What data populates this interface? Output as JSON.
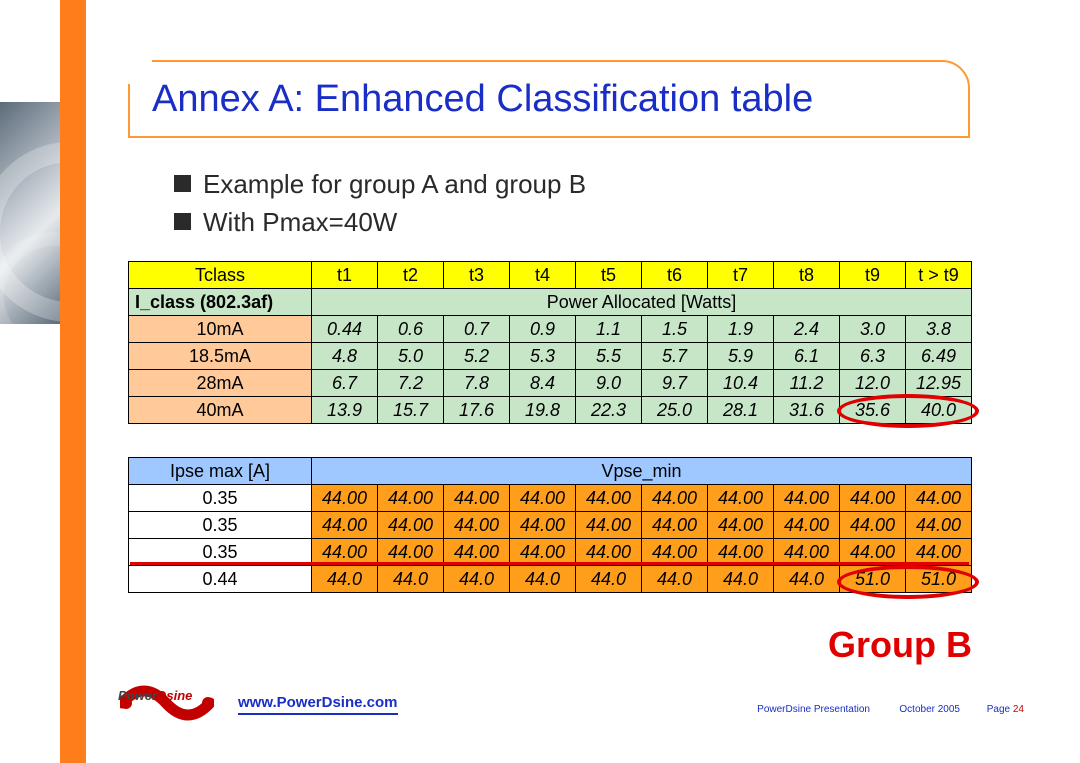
{
  "title": "Annex A: Enhanced Classification table",
  "bullets": [
    "Example for group A and group B",
    "With Pmax=40W"
  ],
  "chart_data": {
    "type": "table",
    "table1": {
      "header": [
        "Tclass",
        "t1",
        "t2",
        "t3",
        "t4",
        "t5",
        "t6",
        "t7",
        "t8",
        "t9",
        "t > t9"
      ],
      "sub_label": "I_class (802.3af)",
      "sub_span": "Power Allocated [Watts]",
      "rows": [
        {
          "label": "10mA",
          "vals": [
            "0.44",
            "0.6",
            "0.7",
            "0.9",
            "1.1",
            "1.5",
            "1.9",
            "2.4",
            "3.0",
            "3.8"
          ]
        },
        {
          "label": "18.5mA",
          "vals": [
            "4.8",
            "5.0",
            "5.2",
            "5.3",
            "5.5",
            "5.7",
            "5.9",
            "6.1",
            "6.3",
            "6.49"
          ]
        },
        {
          "label": "28mA",
          "vals": [
            "6.7",
            "7.2",
            "7.8",
            "8.4",
            "9.0",
            "9.7",
            "10.4",
            "11.2",
            "12.0",
            "12.95"
          ]
        },
        {
          "label": "40mA",
          "vals": [
            "13.9",
            "15.7",
            "17.6",
            "19.8",
            "22.3",
            "25.0",
            "28.1",
            "31.6",
            "35.6",
            "40.0"
          ]
        }
      ]
    },
    "table2": {
      "header_left": "Ipse max [A]",
      "header_span": "Vpse_min",
      "rows": [
        {
          "label": "0.35",
          "vals": [
            "44.00",
            "44.00",
            "44.00",
            "44.00",
            "44.00",
            "44.00",
            "44.00",
            "44.00",
            "44.00",
            "44.00"
          ]
        },
        {
          "label": "0.35",
          "vals": [
            "44.00",
            "44.00",
            "44.00",
            "44.00",
            "44.00",
            "44.00",
            "44.00",
            "44.00",
            "44.00",
            "44.00"
          ]
        },
        {
          "label": "0.35",
          "vals": [
            "44.00",
            "44.00",
            "44.00",
            "44.00",
            "44.00",
            "44.00",
            "44.00",
            "44.00",
            "44.00",
            "44.00"
          ]
        },
        {
          "label": "0.44",
          "vals": [
            "44.0",
            "44.0",
            "44.0",
            "44.0",
            "44.0",
            "44.0",
            "44.0",
            "44.0",
            "51.0",
            "51.0"
          ]
        }
      ]
    }
  },
  "group_label": "Group B",
  "footer": {
    "logo_text": {
      "p": "Power",
      "d": "Dsine"
    },
    "url": "www.PowerDsine.com",
    "presentation": "PowerDsine Presentation",
    "date": "October  2005",
    "page_label": "Page ",
    "page_num": "24"
  }
}
